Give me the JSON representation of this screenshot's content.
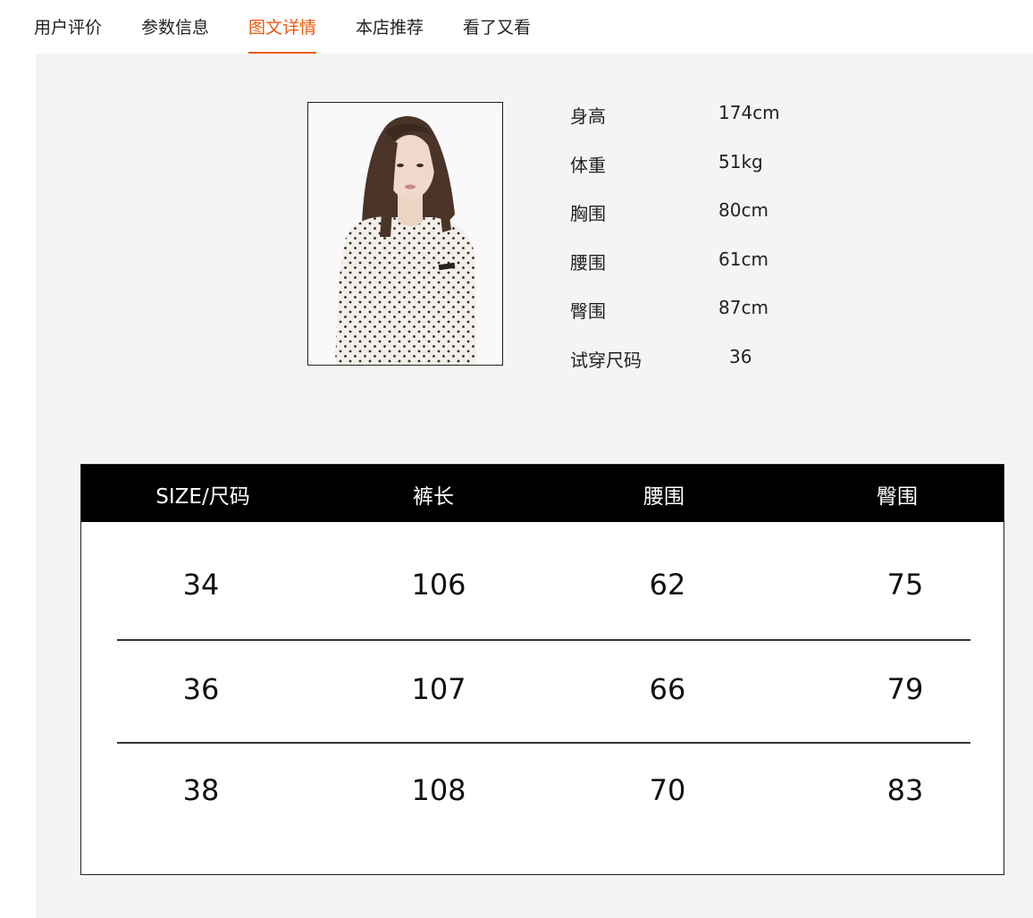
{
  "tabs": [
    {
      "label": "用户评价",
      "active": false
    },
    {
      "label": "参数信息",
      "active": false
    },
    {
      "label": "图文详情",
      "active": true
    },
    {
      "label": "本店推荐",
      "active": false
    },
    {
      "label": "看了又看",
      "active": false
    }
  ],
  "accent_color": "#ec5a12",
  "model": {
    "measurements": [
      {
        "label": "身高",
        "value": "174cm"
      },
      {
        "label": "体重",
        "value": "51kg"
      },
      {
        "label": "胸围",
        "value": "80cm"
      },
      {
        "label": "腰围",
        "value": "61cm"
      },
      {
        "label": "臀围",
        "value": "87cm"
      },
      {
        "label": "试穿尺码",
        "value": "36"
      }
    ]
  },
  "size_table": {
    "headers": [
      "SIZE/尺码",
      "裤长",
      "腰围",
      "臀围"
    ],
    "rows": [
      [
        "34",
        "106",
        "62",
        "75"
      ],
      [
        "36",
        "107",
        "66",
        "79"
      ],
      [
        "38",
        "108",
        "70",
        "83"
      ]
    ]
  }
}
